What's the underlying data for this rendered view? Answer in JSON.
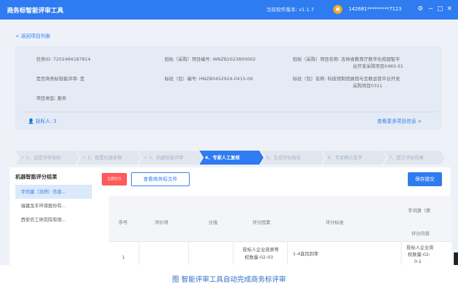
{
  "colors": {
    "accent": "#2f7bf0",
    "danger": "#ff5a5a",
    "caption": "#2f6fc9"
  },
  "titlebar": {
    "title": "商务标智能评审工具",
    "version": "当前软件版本: v1.1.7",
    "avatar_icon": "user-avatar",
    "user": "142681*********7123",
    "controls": [
      "⚙",
      "−",
      "□",
      "✕"
    ]
  },
  "back_link": "< 返回项目列表",
  "info": {
    "task_id": "任务ID: 7202484187814",
    "purchase_id": "招标（采购）项目编号: WNZB2023800002",
    "purchase_name_1": "招标（采购）项目名称: 吉林省教育厅数字化校园智平",
    "purchase_name_2": "台开发采购项目0483-01",
    "smart_review": "是否商务标智能评审: 是",
    "section_id": "标段（包）编号: HNZB0452924-0415-06",
    "section_name_1": "标段（包）名称: 科技馆制馆展馆与互联运营平台开发",
    "section_name_2": "采购项目0311",
    "project_type": "项目类型: 服务",
    "bidders": "投标人: 3",
    "more_link": "查看更多项目信息 >"
  },
  "steps": [
    "✓ 1、设定评审规则",
    "✓ 2、配置机器参数",
    "✓ 3、机器智能评审",
    "4、专家人工复核",
    "5、生成评标报告",
    "6、专家确认签字",
    "7、提交评标结果"
  ],
  "panel": {
    "title": "机器智能评分结果",
    "companies": [
      "宇信建（浩然）信息...",
      "福建龙丰环保股份有...",
      "西安信工研究院有限..."
    ],
    "red_button": "立即打分",
    "view_files_button": "查看商务标文件",
    "save_button": "保存提交"
  },
  "table": {
    "headers": [
      "序号",
      "评价项",
      "分值",
      "评分因素",
      "评分标准",
      "字词源（原"
    ],
    "sub_header": "评分内容",
    "row": {
      "index": "1",
      "factor_1": "投标人企业资质等",
      "factor_2": "权数量-02-03",
      "standard": "1-4直找到率",
      "source_1": "投标人企业资",
      "source_2": "权数量-02-",
      "source_3": "0-1"
    }
  },
  "caption": "图 智能评审工具自动完成商务标评审"
}
